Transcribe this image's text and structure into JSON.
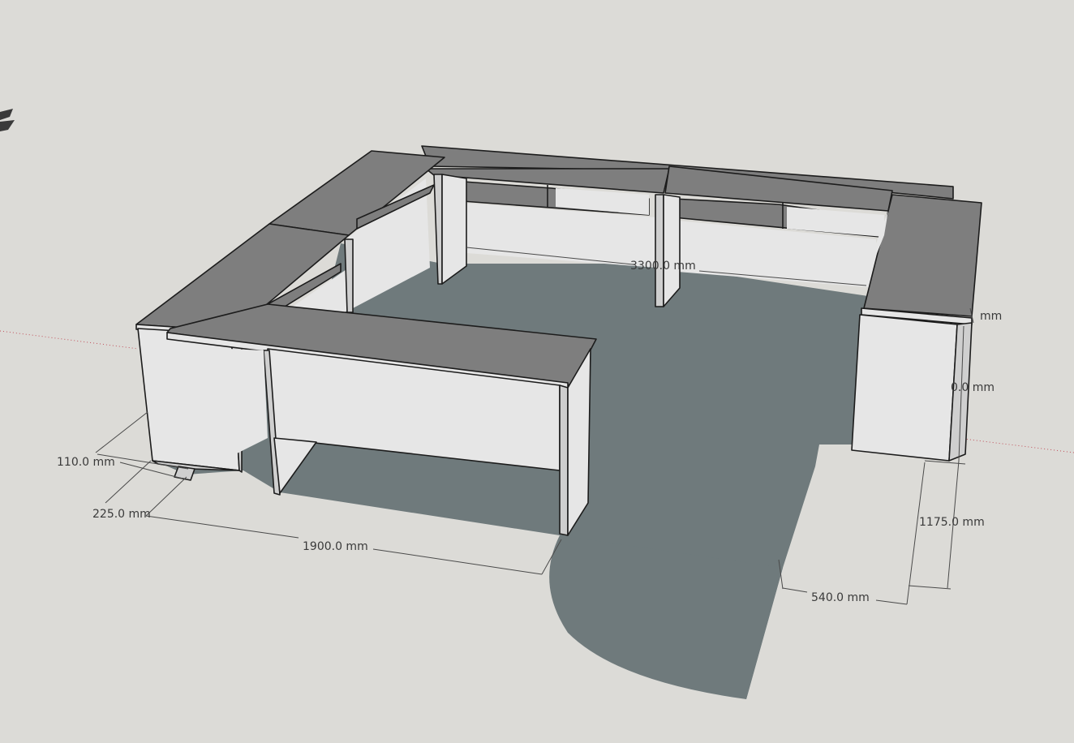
{
  "viewport": {
    "background_color": "#dcdbd7",
    "floor_shadow_color": "#6f7a7c",
    "desk_top_color": "#7e7e7e",
    "desk_side_color": "#e6e6e6",
    "axis_red_color": "#c0505a"
  },
  "dimensions": {
    "d_3300": "3300.0 mm",
    "d_right_small": "mm",
    "d_right_height": "0.0 mm",
    "d_110": "110.0 mm",
    "d_225": "225.0 mm",
    "d_1900": "1900.0 mm",
    "d_1175": "1175.0 mm",
    "d_540": "540.0 mm"
  },
  "icons": {
    "axis_gizmo": "axis-gizmo-icon"
  }
}
